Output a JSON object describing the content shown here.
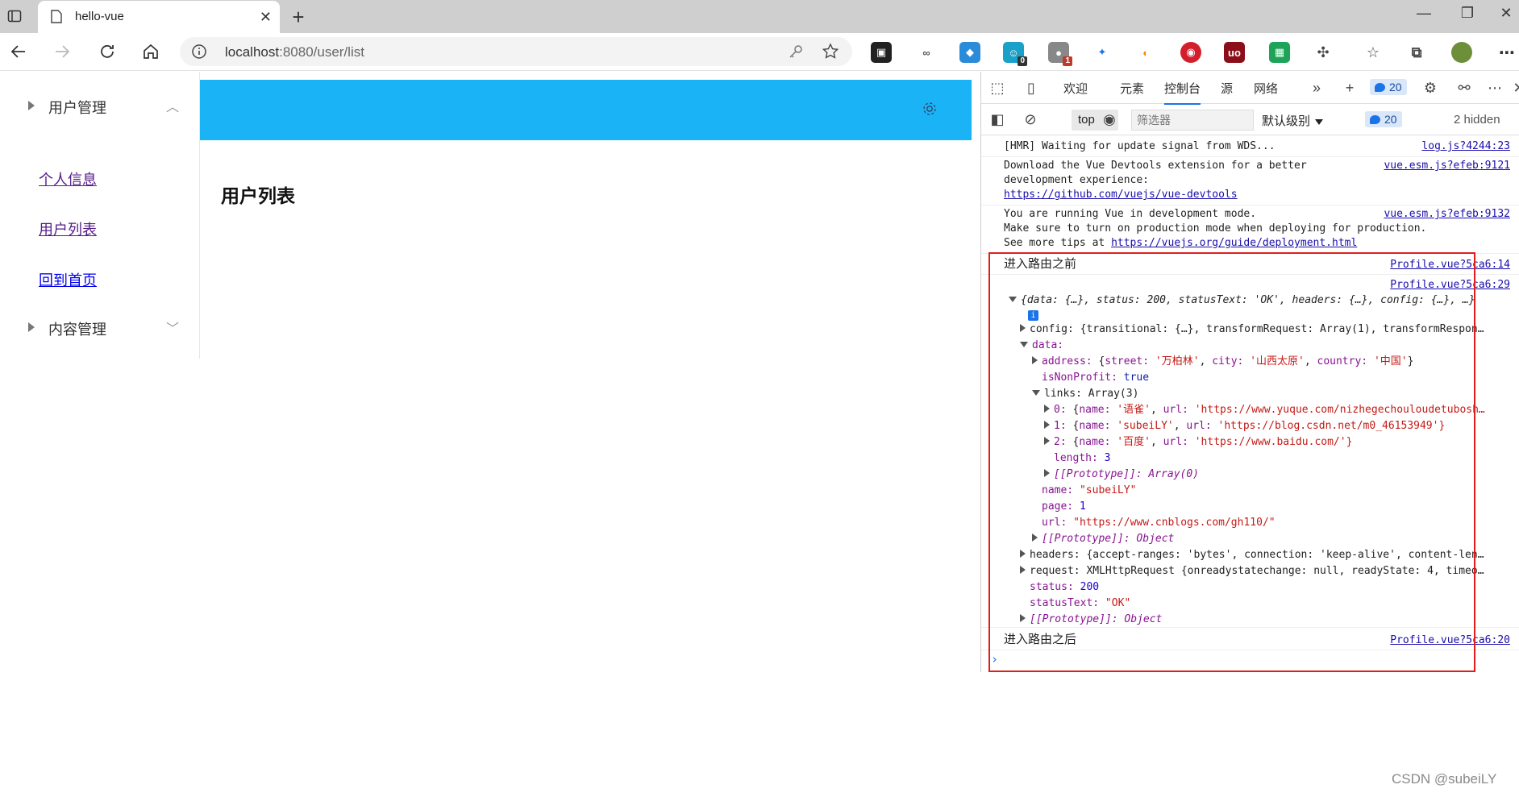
{
  "browser": {
    "tab_title": "hello-vue",
    "url_host": "localhost",
    "url_rest": ":8080/user/list",
    "extension_badges": {
      "ext_a": "0",
      "ext_b": "1"
    }
  },
  "sidebar": {
    "group1_label": "用户管理",
    "items": [
      "个人信息",
      "用户列表",
      "回到首页"
    ],
    "group2_label": "内容管理"
  },
  "main": {
    "title": "用户列表",
    "header_color": "#1ab3f6"
  },
  "devtools": {
    "tabs": [
      "欢迎",
      "元素",
      "控制台",
      "源",
      "网络"
    ],
    "active_tab": "控制台",
    "issue_count": "20",
    "context": "top",
    "filter_placeholder": "筛选器",
    "level": "默认级别",
    "msg_count": "20",
    "hidden": "2 hidden",
    "messages": {
      "hmr": {
        "text": "[HMR] Waiting for update signal from WDS...",
        "src": "log.js?4244:23"
      },
      "devtools_ext": {
        "line1": "Download the Vue Devtools extension for a better",
        "line2": "development experience:",
        "link": "https://github.com/vuejs/vue-devtools",
        "src": "vue.esm.js?efeb:9121"
      },
      "devmode": {
        "line1": "You are running Vue in development mode.",
        "line2": "Make sure to turn on production mode when deploying for production.",
        "line3_pre": "See more tips at ",
        "link": "https://vuejs.org/guide/deployment.html",
        "src": "vue.esm.js?efeb:9132"
      },
      "before": {
        "text": "进入路由之前",
        "src": "Profile.vue?5ca6:14"
      },
      "object": {
        "src": "Profile.vue?5ca6:29",
        "summary": "{data: {…}, status: 200, statusText: 'OK', headers: {…}, config: {…}, …}",
        "config": "config: {transitional: {…}, transformRequest: Array(1), transformRespon…",
        "data_label": "data:",
        "address": {
          "key": "address: ",
          "street_k": "street: ",
          "street_v": "'万柏林'",
          "city_k": "city: ",
          "city_v": "'山西太原'",
          "country_k": "country: ",
          "country_v": "'中国'"
        },
        "isNonProfit": {
          "key": "isNonProfit: ",
          "value": "true"
        },
        "links_label": "links: Array(3)",
        "link0": {
          "idx": "0: ",
          "name_v": "'语雀'",
          "url_v": "'https://www.yuque.com/nizhegechouloudetubosh…"
        },
        "link1": {
          "idx": "1: ",
          "name_v": "'subeiLY'",
          "url_v": "'https://blog.csdn.net/m0_46153949'}"
        },
        "link2": {
          "idx": "2: ",
          "name_v": "'百度'",
          "url_v": "'https://www.baidu.com/'}"
        },
        "length": {
          "key": "length: ",
          "value": "3"
        },
        "proto_array": "[[Prototype]]: Array(0)",
        "name": {
          "key": "name: ",
          "value": "\"subeiLY\""
        },
        "page": {
          "key": "page: ",
          "value": "1"
        },
        "url": {
          "key": "url: ",
          "value": "\"https://www.cnblogs.com/gh110/\""
        },
        "proto_obj1": "[[Prototype]]: Object",
        "headers": "headers: {accept-ranges: 'bytes', connection: 'keep-alive', content-len…",
        "request": "request: XMLHttpRequest {onreadystatechange: null, readyState: 4, timeo…",
        "status": {
          "key": "status: ",
          "value": "200"
        },
        "statusText": {
          "key": "statusText: ",
          "value": "\"OK\""
        },
        "proto_obj2": "[[Prototype]]: Object"
      },
      "after": {
        "text": "进入路由之后",
        "src": "Profile.vue?5ca6:20"
      }
    }
  },
  "highlight_color": "#e41c1c",
  "watermark": "CSDN @subeiLY"
}
